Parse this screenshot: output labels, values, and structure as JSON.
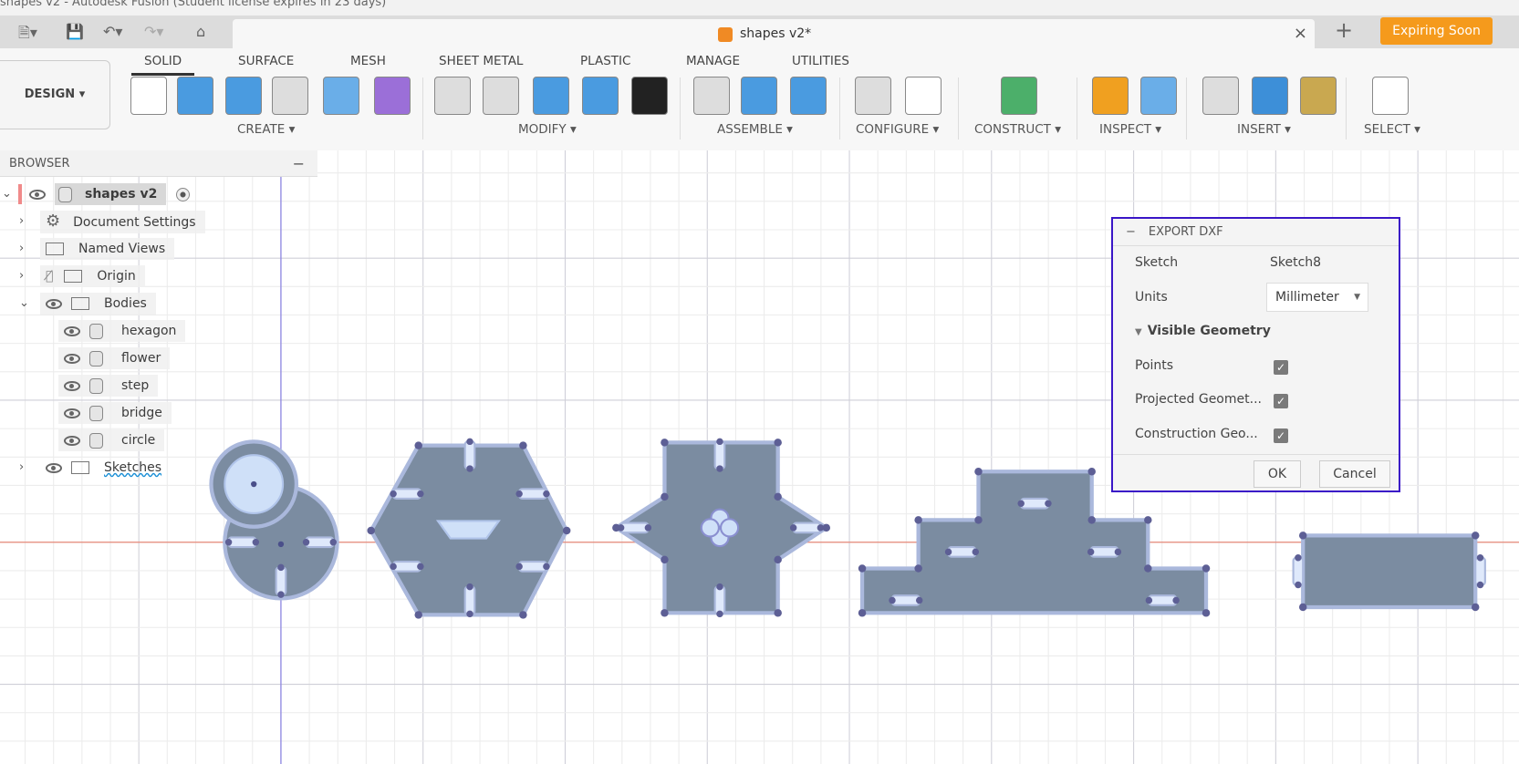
{
  "window_title": "shapes v2 - Autodesk Fusion (Student license expires in 23 days)",
  "document_tab": {
    "name": "shapes v2*",
    "close": "×"
  },
  "new_tab": "+",
  "expiring_button": "Expiring Soon",
  "workspace": "DESIGN ▾",
  "ribbon_tabs": [
    "SOLID",
    "SURFACE",
    "MESH",
    "SHEET METAL",
    "PLASTIC",
    "MANAGE",
    "UTILITIES"
  ],
  "ribbon_groups": [
    "CREATE ▾",
    "MODIFY ▾",
    "ASSEMBLE ▾",
    "CONFIGURE ▾",
    "CONSTRUCT ▾",
    "INSPECT ▾",
    "INSERT ▾",
    "SELECT ▾"
  ],
  "browser": {
    "title": "BROWSER",
    "collapse": "−",
    "root": "shapes v2",
    "items": [
      "Document Settings",
      "Named Views",
      "Origin",
      "Bodies",
      "Sketches"
    ],
    "bodies": [
      "hexagon",
      "flower",
      "step",
      "bridge",
      "circle"
    ]
  },
  "export_dxf": {
    "title": "EXPORT DXF",
    "sketch_label": "Sketch",
    "sketch_value": "Sketch8",
    "units_label": "Units",
    "units_value": "Millimeter",
    "section": "Visible Geometry",
    "points": "Points",
    "projected": "Projected Geomet...",
    "construction": "Construction Geo...",
    "checked": "✓",
    "ok": "OK",
    "cancel": "Cancel"
  },
  "colors": {
    "accent": "#f59a1c",
    "dialog_border": "#3a16c7",
    "body_fill": "#7b8ca1"
  }
}
